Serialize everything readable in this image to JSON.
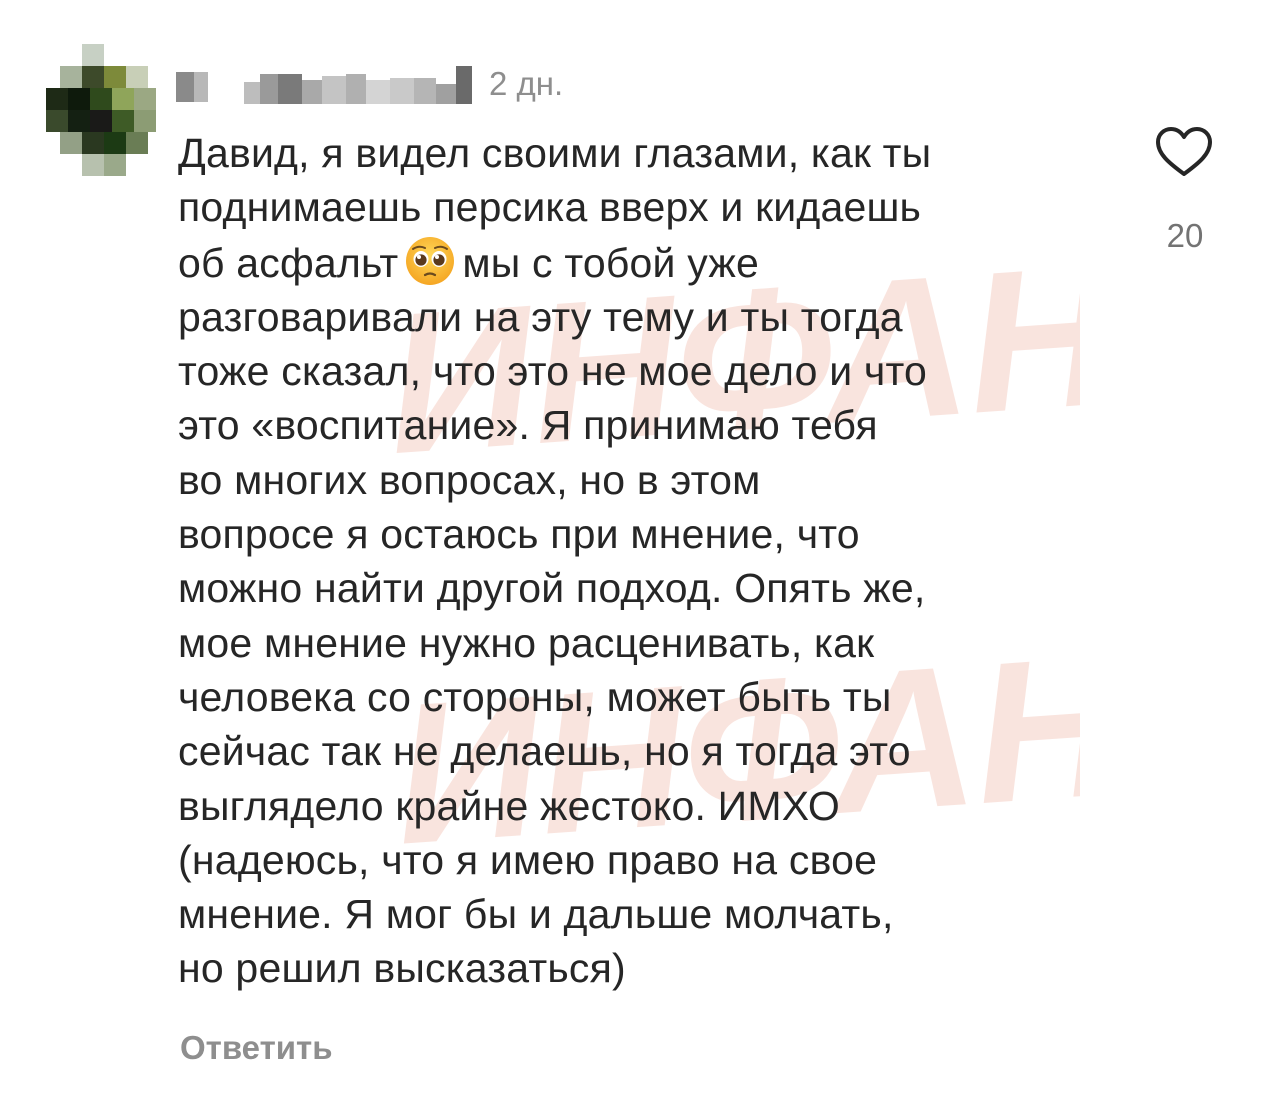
{
  "comment": {
    "time": "2 дн.",
    "lines": [
      "Давид, я видел своими глазами, как ты",
      "поднимаешь персика вверх и кидаешь",
      "об асфальт",
      "мы с тобой уже",
      "разговаривали на эту тему и ты тогда",
      "тоже сказал, что это не мое дело и что",
      "это «воспитание». Я принимаю тебя",
      "во многих вопросах, но в этом",
      "вопросе я остаюсь при мнение, что",
      "можно найти другой подход. Опять же,",
      "мое мнение нужно расценивать, как",
      "человека со стороны, может быть ты",
      "сейчас так не делаешь, но я тогда это",
      "выглядело крайне жестоко. ИМХО",
      "(надеюсь, что я имею право на свое",
      "мнение. Я мог бы и дальше молчать,",
      "но решил высказаться)"
    ],
    "emoji": "pleading-face-emoji",
    "likes": "20",
    "reply_label": "Ответить"
  },
  "watermark": {
    "text_top": "ИНФАН",
    "text_bottom": "ИНФАН"
  },
  "colors": {
    "text": "#262626",
    "secondary": "#8e8e8e",
    "watermark": "#f3c4b8"
  },
  "icons": {
    "like": "heart-outline-icon"
  }
}
